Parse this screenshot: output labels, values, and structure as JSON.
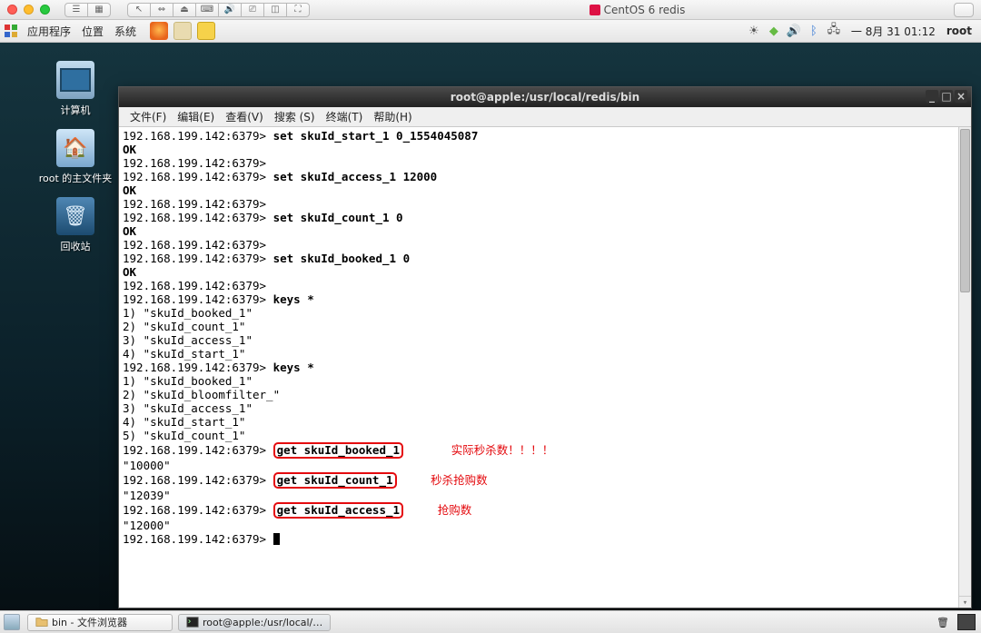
{
  "mac": {
    "title": "CentOS 6 redis"
  },
  "gnome": {
    "menu_apps": "应用程序",
    "menu_places": "位置",
    "menu_system": "系统",
    "date": "一 8月 31 01:12",
    "user": "root"
  },
  "desktop": {
    "icons": [
      {
        "name": "computer",
        "label": "计算机"
      },
      {
        "name": "home",
        "label": "root 的主文件夹"
      },
      {
        "name": "trash",
        "label": "回收站"
      }
    ]
  },
  "terminal": {
    "title": "root@apple:/usr/local/redis/bin",
    "menus": [
      "文件(F)",
      "编辑(E)",
      "查看(V)",
      "搜索 (S)",
      "终端(T)",
      "帮助(H)"
    ],
    "prompt": "192.168.199.142:6379>",
    "lines": {
      "l1_cmd": "set skuId_start_1 0_1554045087",
      "l2": "OK",
      "l4_cmd": "set skuId_access_1 12000",
      "l5": "OK",
      "l7_cmd": "set skuId_count_1 0",
      "l8": "OK",
      "l10_cmd": "set skuId_booked_1 0",
      "l11": "OK",
      "l13_cmd": "keys *",
      "k1_1": "1) \"skuId_booked_1\"",
      "k1_2": "2) \"skuId_count_1\"",
      "k1_3": "3) \"skuId_access_1\"",
      "k1_4": "4) \"skuId_start_1\"",
      "l18_cmd": "keys *",
      "k2_1": "1) \"skuId_booked_1\"",
      "k2_2": "2) \"skuId_bloomfilter_\"",
      "k2_3": "3) \"skuId_access_1\"",
      "k2_4": "4) \"skuId_start_1\"",
      "k2_5": "5) \"skuId_count_1\"",
      "g1_cmd": "get skuId_booked_1",
      "g1_res": "\"10000\"",
      "g2_cmd": "get skuId_count_1",
      "g2_res": "\"12039\"",
      "g3_cmd": "get skuId_access_1",
      "g3_res": "\"12000\""
    },
    "annotations": {
      "a1": "实际秒杀数！！！！",
      "a2": "秒杀抢购数",
      "a3": "抢购数"
    }
  },
  "taskbar": {
    "task1": "bin - 文件浏览器",
    "task2": "root@apple:/usr/local/…"
  }
}
